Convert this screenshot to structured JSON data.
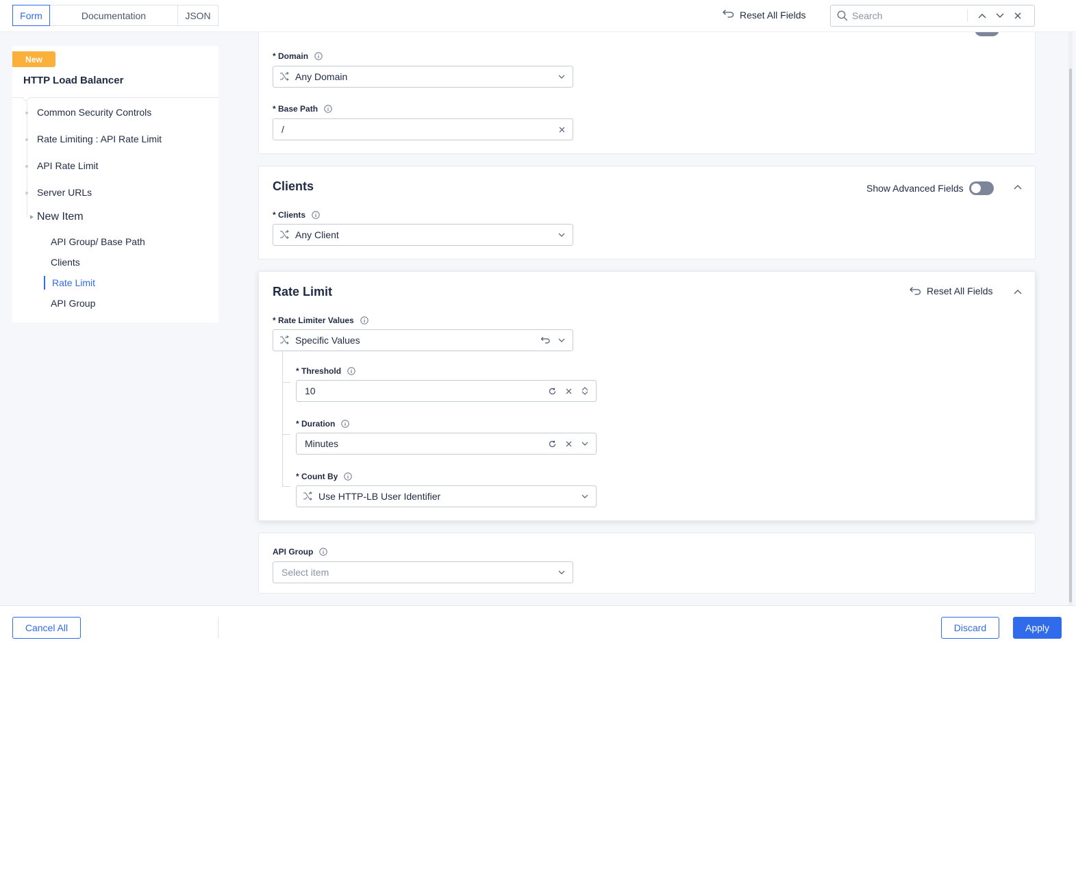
{
  "tabs": [
    {
      "label": "Form"
    },
    {
      "label": "Documentation"
    },
    {
      "label": "JSON"
    }
  ],
  "header": {
    "reset_label": "Reset All Fields",
    "search_placeholder": "Search"
  },
  "sidebar": {
    "badge": "New",
    "title": "HTTP Load Balancer",
    "items": [
      {
        "label": "Common Security Controls"
      },
      {
        "label": "Rate Limiting : API Rate Limit"
      },
      {
        "label": "API Rate Limit"
      },
      {
        "label": "Server URLs"
      },
      {
        "label": "New Item"
      }
    ],
    "subitems": [
      {
        "label": "API Group/ Base Path"
      },
      {
        "label": "Clients"
      },
      {
        "label": "Rate Limit"
      },
      {
        "label": "API Group"
      }
    ]
  },
  "top_section": {
    "domain_label": "Domain",
    "domain_value": "Any Domain",
    "base_path_label": "Base Path",
    "base_path_value": "/"
  },
  "clients_section": {
    "title": "Clients",
    "advanced_label": "Show Advanced Fields",
    "clients_label": "Clients",
    "clients_value": "Any Client"
  },
  "rate_section": {
    "title": "Rate Limit",
    "reset_label": "Reset All Fields",
    "values_label": "Rate Limiter Values",
    "values_value": "Specific Values",
    "threshold_label": "Threshold",
    "threshold_value": "10",
    "duration_label": "Duration",
    "duration_value": "Minutes",
    "countby_label": "Count By",
    "countby_value": "Use HTTP-LB User Identifier"
  },
  "apigroup_section": {
    "label": "API Group",
    "placeholder": "Select item"
  },
  "footer": {
    "cancel_label": "Cancel All",
    "discard_label": "Discard",
    "apply_label": "Apply"
  },
  "required_mark": "*",
  "colors": {
    "accent": "#2f6bea",
    "badge": "#fbb03b",
    "toggle_off": "#7d8698"
  }
}
